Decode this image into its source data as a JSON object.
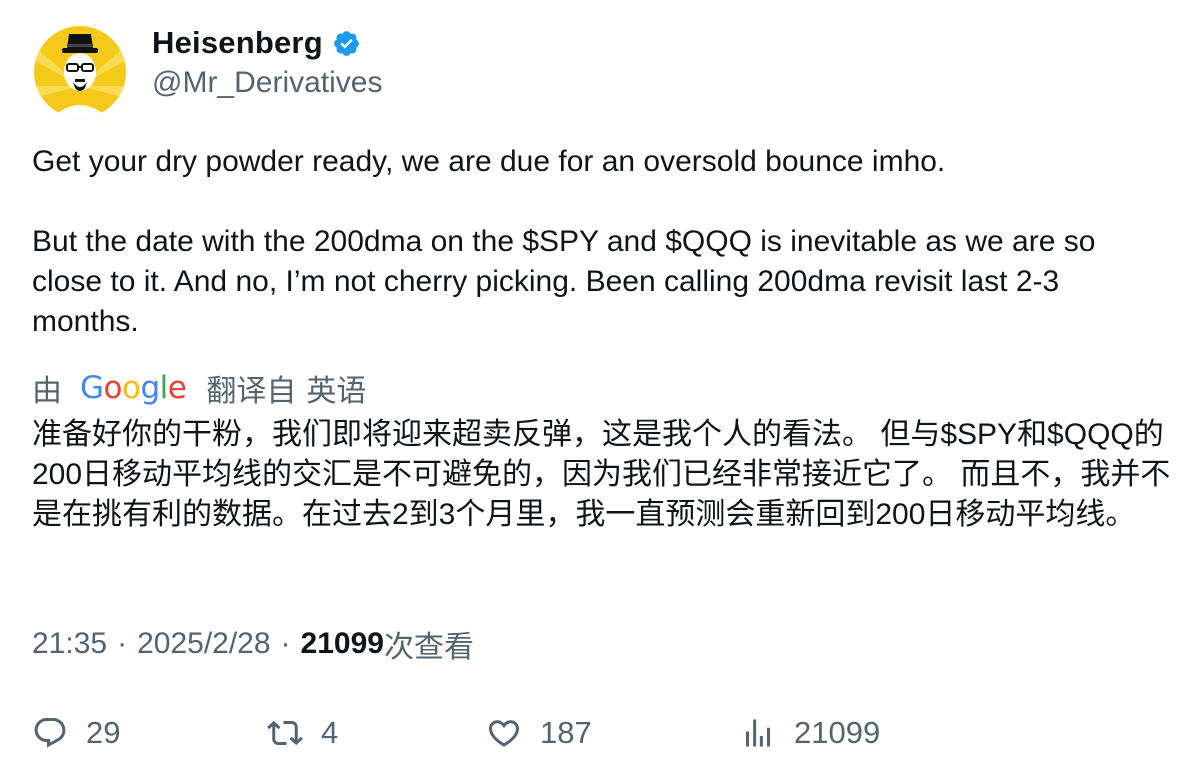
{
  "author": {
    "display_name": "Heisenberg",
    "handle": "@Mr_Derivatives",
    "verified_icon": "verified-badge-icon",
    "avatar_icon": "heisenberg-avatar",
    "verified_color": "#1d9bf0",
    "avatar_bg": "#f5c91a"
  },
  "tweet": {
    "paragraphs": [
      "Get your dry powder ready, we are due for an oversold bounce imho.",
      "But the date with the 200dma on the $SPY and $QQQ is inevitable as we are so close to it. And no, I’m not cherry picking. Been calling 200dma revisit last 2-3 months."
    ]
  },
  "translation": {
    "by_label": "由",
    "provider_logo": [
      "G",
      "o",
      "o",
      "g",
      "l",
      "e"
    ],
    "translated_from_label": "翻译自",
    "source_language": "英语",
    "translated_text": "准备好你的干粉，我们即将迎来超卖反弹，这是我个人的看法。 但与$SPY和$QQQ的200日移动平均线的交汇是不可避免的，因为我们已经非常接近它了。 而且不，我并不是在挑有利的数据。在过去2到3个月里，我一直预测会重新回到200日移动平均线。"
  },
  "meta": {
    "time": "21:35",
    "separator": "·",
    "date": "2025/2/28",
    "views_count": "21099",
    "views_label": "次查看"
  },
  "actions": {
    "reply": {
      "icon": "reply-icon",
      "count": "29"
    },
    "retweet": {
      "icon": "retweet-icon",
      "count": "4"
    },
    "like": {
      "icon": "heart-icon",
      "count": "187"
    },
    "views": {
      "icon": "analytics-icon",
      "count": "21099"
    }
  },
  "colors": {
    "text_primary": "#0f1419",
    "text_secondary": "#536471",
    "accent": "#1d9bf0"
  }
}
